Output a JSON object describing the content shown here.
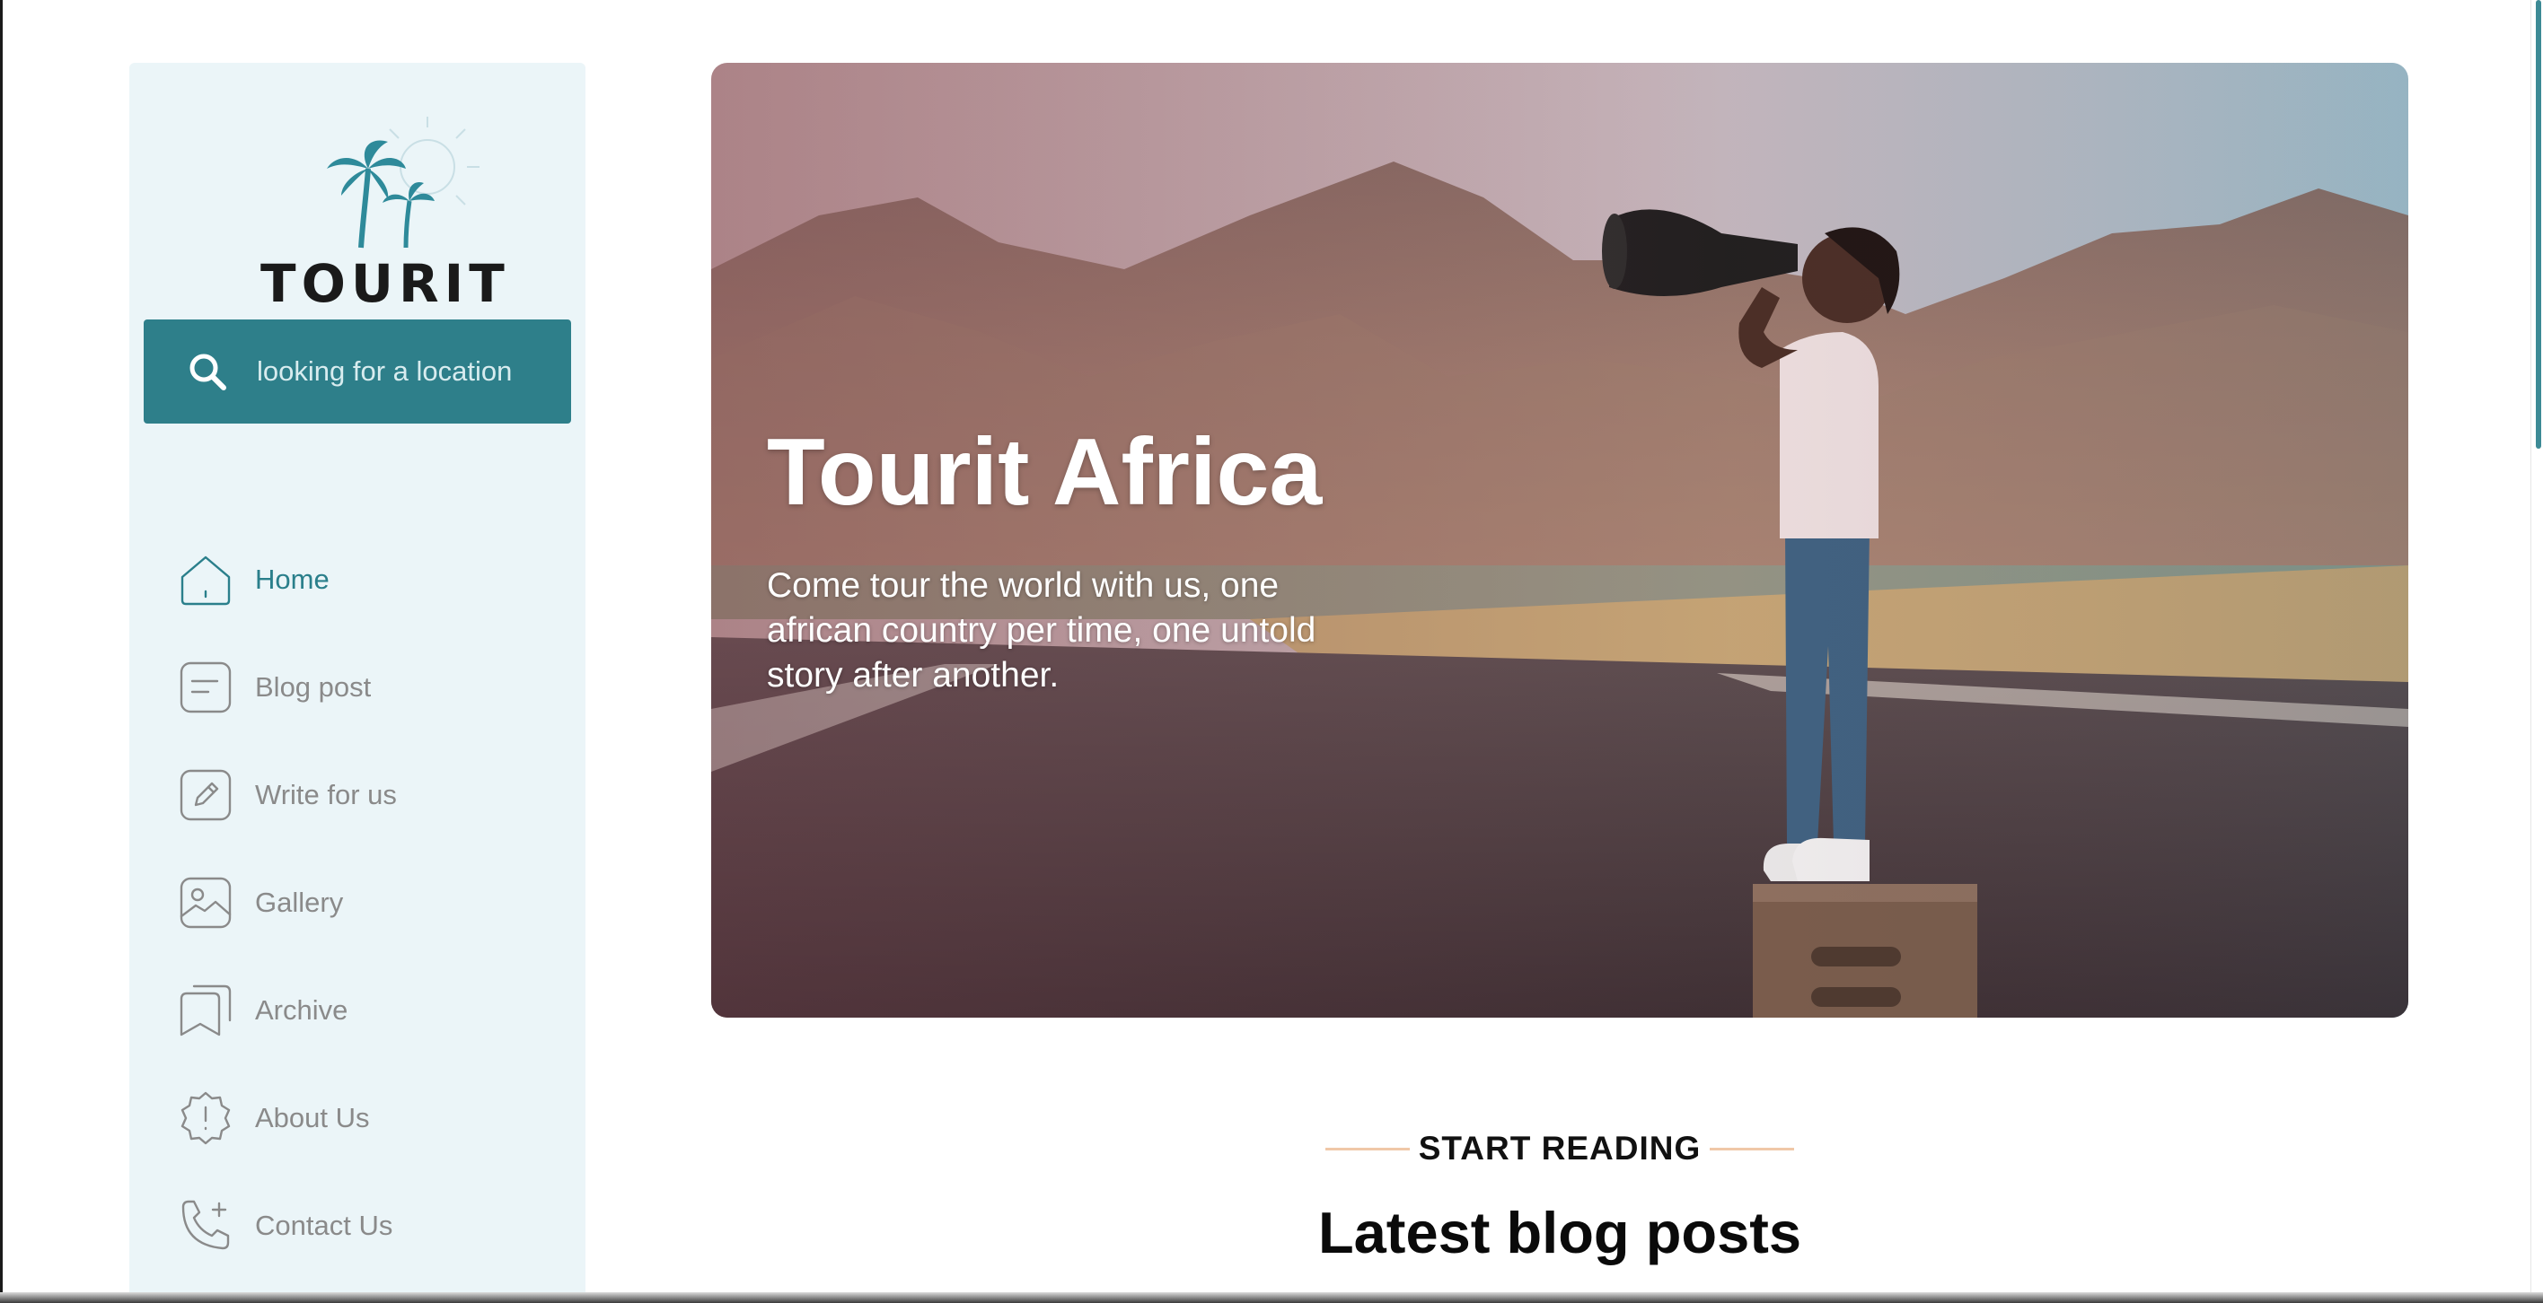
{
  "brand": {
    "logo_text": "TOURIT"
  },
  "search": {
    "placeholder": "looking for a location"
  },
  "nav": {
    "items": [
      {
        "label": "Home",
        "icon": "home-icon",
        "active": true
      },
      {
        "label": "Blog post",
        "icon": "document-icon",
        "active": false
      },
      {
        "label": "Write for us",
        "icon": "pencil-icon",
        "active": false
      },
      {
        "label": "Gallery",
        "icon": "image-icon",
        "active": false
      },
      {
        "label": "Archive",
        "icon": "bookmarks-icon",
        "active": false
      },
      {
        "label": "About Us",
        "icon": "info-badge-icon",
        "active": false
      },
      {
        "label": "Contact Us",
        "icon": "phone-add-icon",
        "active": false
      }
    ]
  },
  "hero": {
    "title": "Tourit Africa",
    "subtitle": "Come tour the world with us, one african country per time, one untold story after another."
  },
  "section": {
    "kicker": "START READING",
    "title": "Latest blog posts"
  },
  "colors": {
    "accent": "#2e7f8a",
    "sidebar_bg": "#ebf5f8",
    "active_nav": "#2a7f8b",
    "inactive_nav": "#8a8a8a",
    "kicker_line": "#f0c8a8"
  }
}
